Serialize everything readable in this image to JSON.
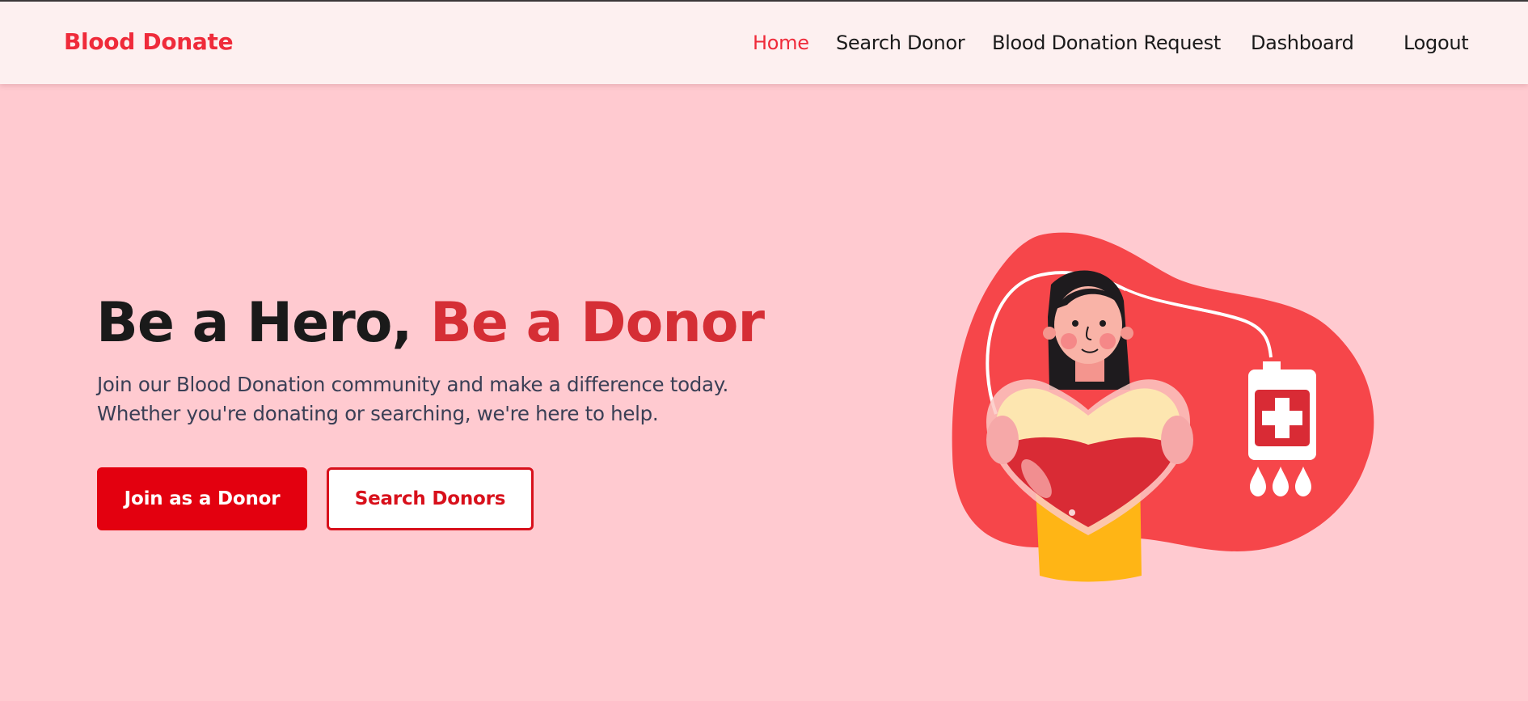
{
  "nav": {
    "brand": "Blood Donate",
    "links": [
      {
        "label": "Home",
        "active": true
      },
      {
        "label": "Search Donor"
      },
      {
        "label": "Blood Donation Request"
      },
      {
        "label": "Dashboard"
      },
      {
        "label": "Logout"
      }
    ]
  },
  "hero": {
    "title_part1": "Be a Hero, ",
    "title_part2": "Be a Donor",
    "subtitle_line1": "Join our Blood Donation community and make a difference today.",
    "subtitle_line2": "Whether you're donating or searching, we're here to help.",
    "primary_button": "Join as a Donor",
    "secondary_button": "Search Donors"
  },
  "colors": {
    "accent": "#ef2b3a",
    "page_background": "#ffcad0",
    "primary_button": "#e3000f"
  },
  "illustration": {
    "description_icons": [
      "blood-bag-icon",
      "blood-drop-icon",
      "heart-icon",
      "person"
    ]
  }
}
